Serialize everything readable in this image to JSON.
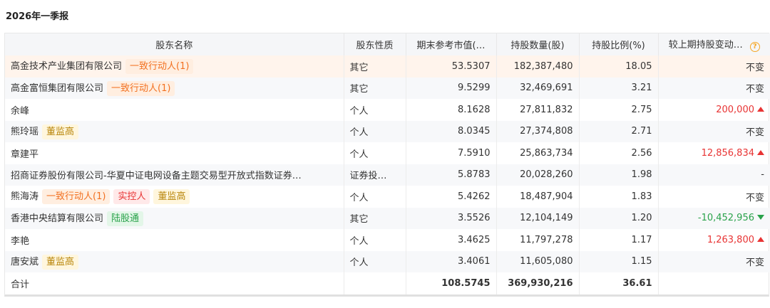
{
  "report_title": "2026年一季报",
  "columns": {
    "name": "股东名称",
    "nature": "股东性质",
    "market_value": "期末参考市值(…",
    "shares": "持股数量(股)",
    "ratio": "持股比例(%)",
    "change": "较上期持股变动…",
    "help_glyph": "?"
  },
  "rows": [
    {
      "name": "高金技术产业集团有限公司",
      "tags": [
        {
          "text": "一致行动人(1)",
          "style": "orange"
        }
      ],
      "nature": "其它",
      "market_value": "53.5307",
      "shares": "182,387,480",
      "ratio": "18.05",
      "change": "不变",
      "change_dir": "none"
    },
    {
      "name": "高金富恒集团有限公司",
      "tags": [
        {
          "text": "一致行动人(1)",
          "style": "orange"
        }
      ],
      "nature": "其它",
      "market_value": "9.5299",
      "shares": "32,469,691",
      "ratio": "3.21",
      "change": "不变",
      "change_dir": "none"
    },
    {
      "name": "余峰",
      "tags": [],
      "nature": "个人",
      "market_value": "8.1628",
      "shares": "27,811,832",
      "ratio": "2.75",
      "change": "200,000",
      "change_dir": "up"
    },
    {
      "name": "熊玲瑶",
      "tags": [
        {
          "text": "董监高",
          "style": "yellow"
        }
      ],
      "nature": "个人",
      "market_value": "8.0345",
      "shares": "27,374,808",
      "ratio": "2.71",
      "change": "不变",
      "change_dir": "none"
    },
    {
      "name": "章建平",
      "tags": [],
      "nature": "个人",
      "market_value": "7.5910",
      "shares": "25,863,734",
      "ratio": "2.56",
      "change": "12,856,834",
      "change_dir": "up"
    },
    {
      "name": "招商证券股份有限公司-华夏中证电网设备主题交易型开放式指数证券…",
      "tags": [],
      "nature": "证券投…",
      "market_value": "5.8783",
      "shares": "20,028,260",
      "ratio": "1.98",
      "change": "-",
      "change_dir": "none"
    },
    {
      "name": "熊海涛",
      "tags": [
        {
          "text": "一致行动人(1)",
          "style": "orange"
        },
        {
          "text": "实控人",
          "style": "red"
        },
        {
          "text": "董监高",
          "style": "yellow"
        }
      ],
      "nature": "个人",
      "market_value": "5.4262",
      "shares": "18,487,904",
      "ratio": "1.83",
      "change": "不变",
      "change_dir": "none"
    },
    {
      "name": "香港中央结算有限公司",
      "tags": [
        {
          "text": "陆股通",
          "style": "green"
        }
      ],
      "nature": "其它",
      "market_value": "3.5526",
      "shares": "12,104,149",
      "ratio": "1.20",
      "change": "-10,452,956",
      "change_dir": "down"
    },
    {
      "name": "李艳",
      "tags": [],
      "nature": "个人",
      "market_value": "3.4625",
      "shares": "11,797,278",
      "ratio": "1.17",
      "change": "1,263,800",
      "change_dir": "up"
    },
    {
      "name": "唐安斌",
      "tags": [
        {
          "text": "董监高",
          "style": "yellow"
        }
      ],
      "nature": "个人",
      "market_value": "3.4061",
      "shares": "11,605,080",
      "ratio": "1.15",
      "change": "不变",
      "change_dir": "none"
    }
  ],
  "total": {
    "label": "合计",
    "market_value": "108.5745",
    "shares": "369,930,216",
    "ratio": "36.61"
  },
  "colors": {
    "up": "#e83434",
    "down": "#2aa24b",
    "highlight_row": "#fff4ec"
  }
}
